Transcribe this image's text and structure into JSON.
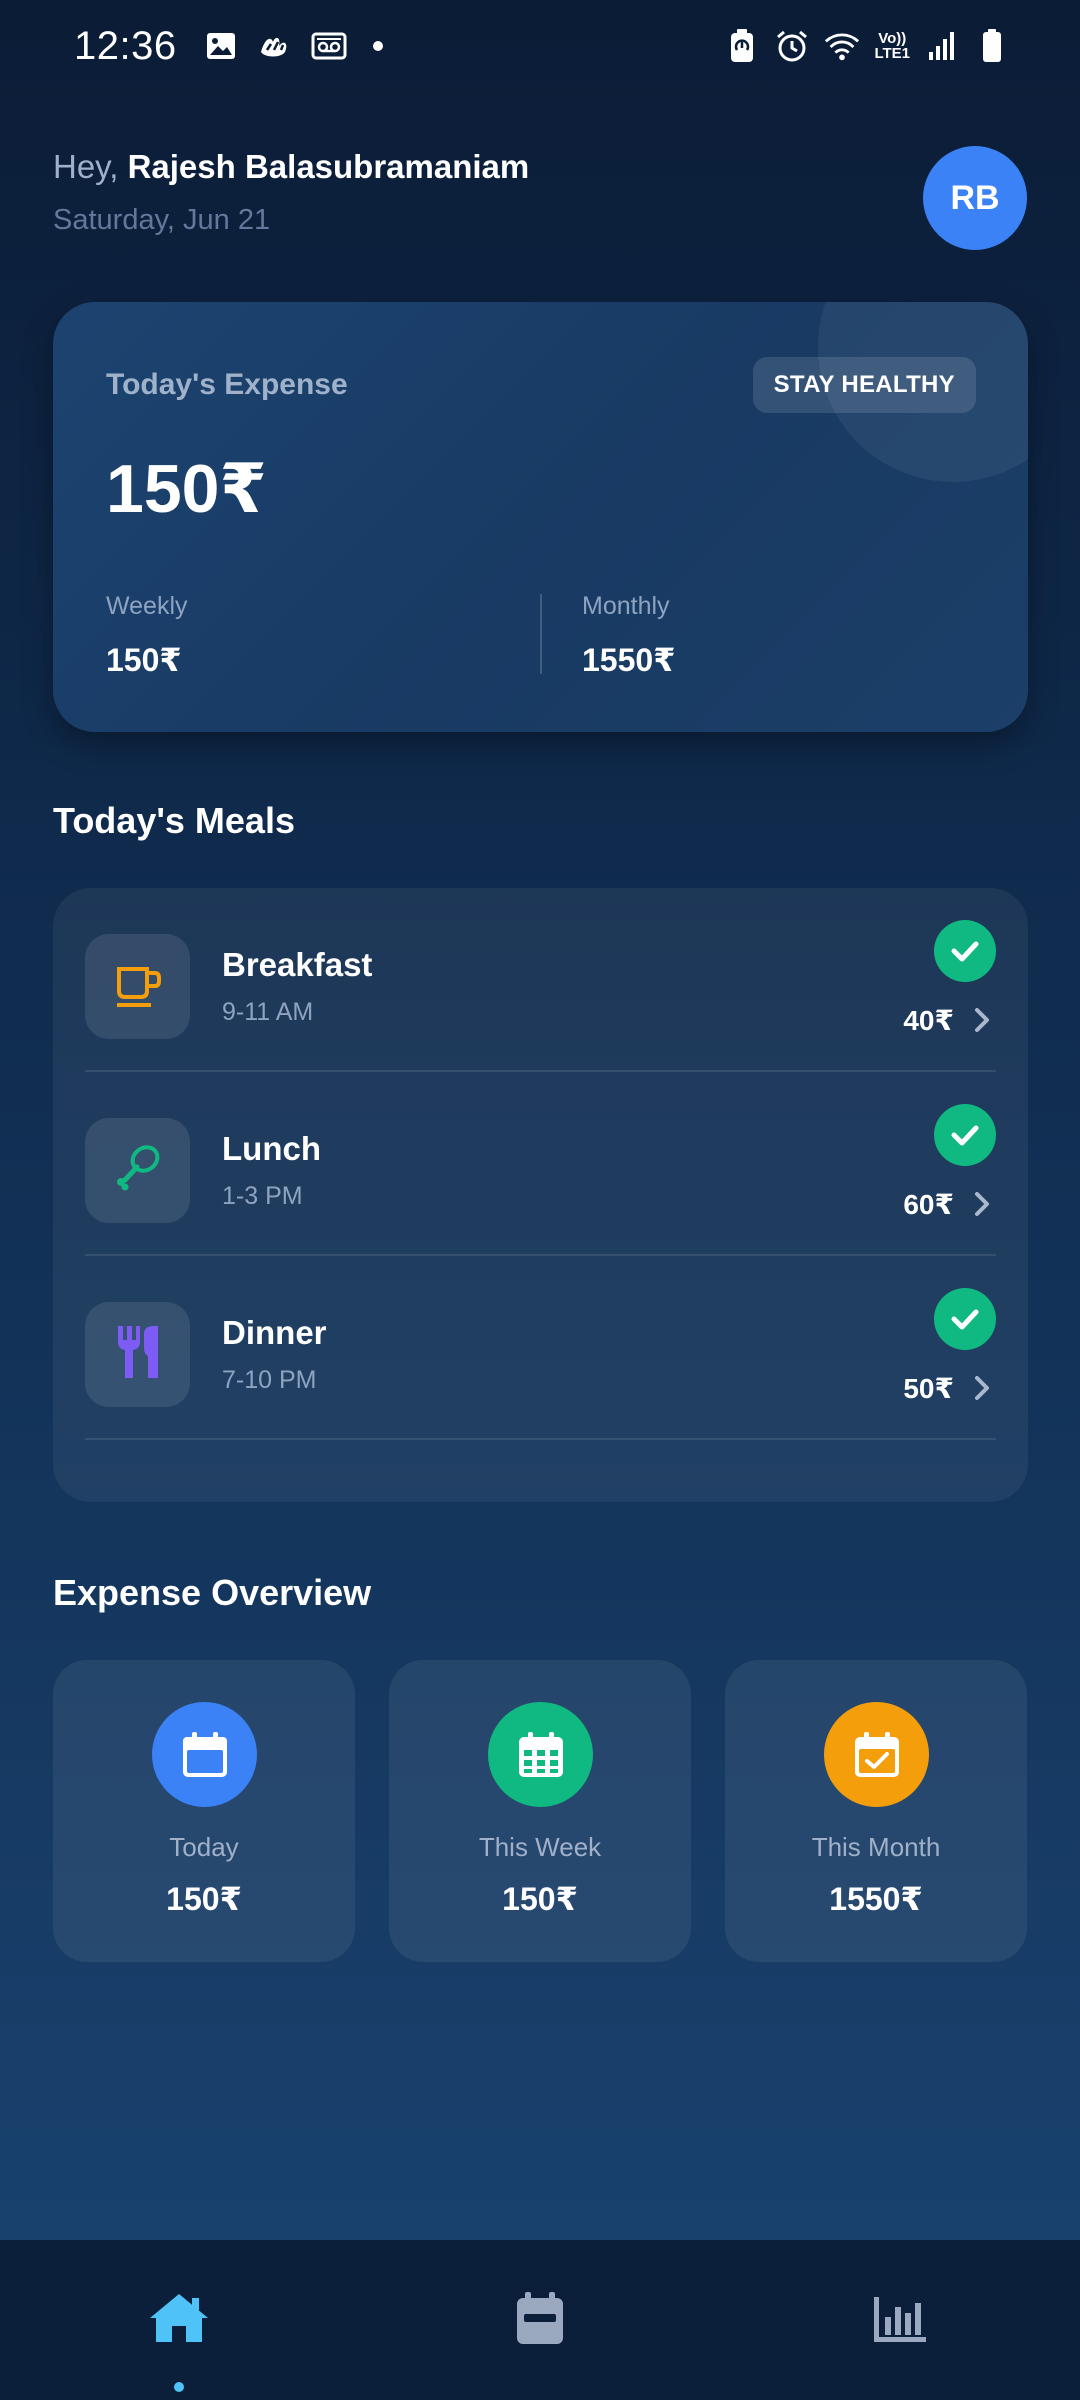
{
  "status_bar": {
    "time": "12:36",
    "left_icons": [
      "image-icon",
      "app-notification-icon",
      "voicemail-icon",
      "dot-icon"
    ],
    "right_icons": [
      "battery-saver-icon",
      "alarm-icon",
      "wifi-icon",
      "volte-icon",
      "signal-icon",
      "battery-icon"
    ],
    "lte_line1": "Vo))",
    "lte_line2": "LTE1"
  },
  "header": {
    "greeting_prefix": "Hey,",
    "user_name": "Rajesh Balasubramaniam",
    "date": "Saturday, Jun 21",
    "avatar_initials": "RB"
  },
  "expense_card": {
    "label": "Today's Expense",
    "badge": "STAY HEALTHY",
    "amount": "150₹",
    "weekly_label": "Weekly",
    "weekly_value": "150₹",
    "monthly_label": "Monthly",
    "monthly_value": "1550₹"
  },
  "meals_section": {
    "title": "Today's Meals",
    "items": [
      {
        "name": "Breakfast",
        "time": "9-11 AM",
        "price": "40₹",
        "icon": "coffee-cup-icon",
        "icon_color": "#f59e0b",
        "done": true
      },
      {
        "name": "Lunch",
        "time": "1-3 PM",
        "price": "60₹",
        "icon": "drumstick-icon",
        "icon_color": "#10b981",
        "done": true
      },
      {
        "name": "Dinner",
        "time": "7-10 PM",
        "price": "50₹",
        "icon": "fork-knife-icon",
        "icon_color": "#7c5cf5",
        "done": true
      }
    ]
  },
  "overview_section": {
    "title": "Expense Overview",
    "cards": [
      {
        "label": "Today",
        "value": "150₹",
        "icon": "calendar-day-icon",
        "color": "#3b82f6"
      },
      {
        "label": "This Week",
        "value": "150₹",
        "icon": "calendar-week-icon",
        "color": "#10b981"
      },
      {
        "label": "This Month",
        "value": "1550₹",
        "icon": "calendar-check-icon",
        "color": "#f59e0b"
      }
    ]
  },
  "bottom_nav": {
    "items": [
      {
        "icon": "home-icon",
        "active": true,
        "color": "#4fc3f7"
      },
      {
        "icon": "calendar-icon",
        "active": false,
        "color": "#9aa9bf"
      },
      {
        "icon": "bar-chart-icon",
        "active": false,
        "color": "#9aa9bf"
      }
    ]
  },
  "colors": {
    "background_top": "#0b1c36",
    "background_bottom": "#1a4472",
    "accent_blue": "#3b82f6",
    "success_green": "#10b981",
    "warning_orange": "#f59e0b",
    "nav_active": "#4fc3f7"
  }
}
